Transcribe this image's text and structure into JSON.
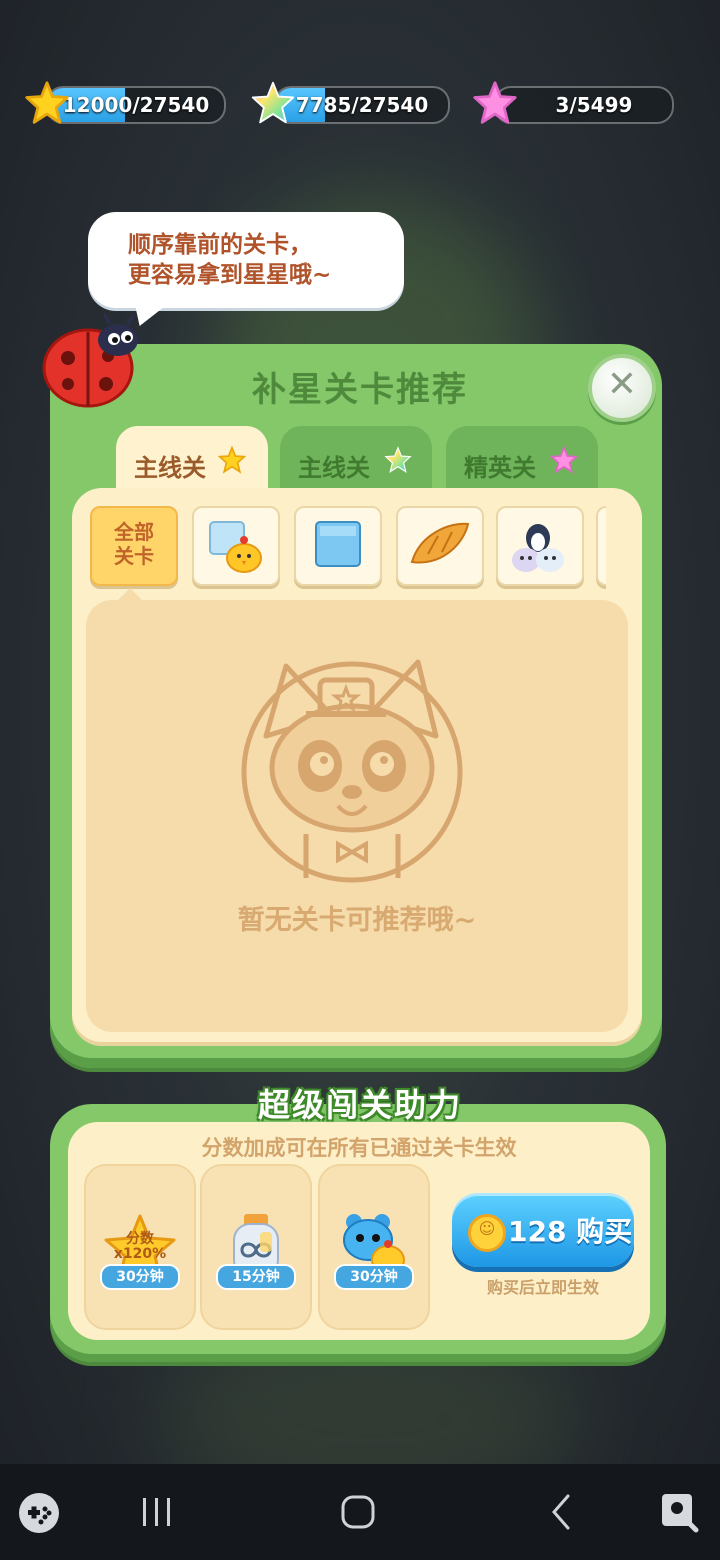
{
  "star_bars": [
    {
      "icon": "yellow-star-icon",
      "value": "12000/27540",
      "progress": 0.436
    },
    {
      "icon": "rainbow-star-icon",
      "value": "7785/27540",
      "progress": 0.283
    },
    {
      "icon": "pink-star-icon",
      "value": "3/5499",
      "progress": 0.0005
    }
  ],
  "bubble": {
    "text": "顺序靠前的关卡，\n更容易拿到星星哦~"
  },
  "panel": {
    "title": "补星关卡推荐",
    "tabs": [
      {
        "label": "主线关",
        "icon": "yellow-star-icon",
        "active": true
      },
      {
        "label": "主线关",
        "icon": "rainbow-star-icon",
        "active": false
      },
      {
        "label": "精英关",
        "icon": "pink-star-icon",
        "active": false
      }
    ],
    "filters": [
      {
        "label": "全部\n关卡",
        "icon": "all-levels",
        "selected": true
      },
      {
        "icon": "chick-on-ice-icon"
      },
      {
        "icon": "ice-block-icon"
      },
      {
        "icon": "croissant-icon"
      },
      {
        "icon": "penguin-seals-icon"
      }
    ],
    "empty_text": "暂无关卡可推荐哦~"
  },
  "boost": {
    "title": "超级闯关助力",
    "subtitle": "分数加成可在所有已通过关卡生效",
    "items": [
      {
        "icon": "score-star-icon",
        "badge_top": "分数",
        "badge_mult": "x120%",
        "duration": "30分钟"
      },
      {
        "icon": "infinity-bottle-icon",
        "duration": "15分钟"
      },
      {
        "icon": "bear-chick-icon",
        "duration": "30分钟"
      }
    ],
    "buy": {
      "price": "128",
      "label": "购买",
      "note": "购买后立即生效"
    }
  },
  "navbar": [
    "game-launcher-icon",
    "recents-icon",
    "home-icon",
    "back-icon",
    "screen-lock-icon"
  ]
}
